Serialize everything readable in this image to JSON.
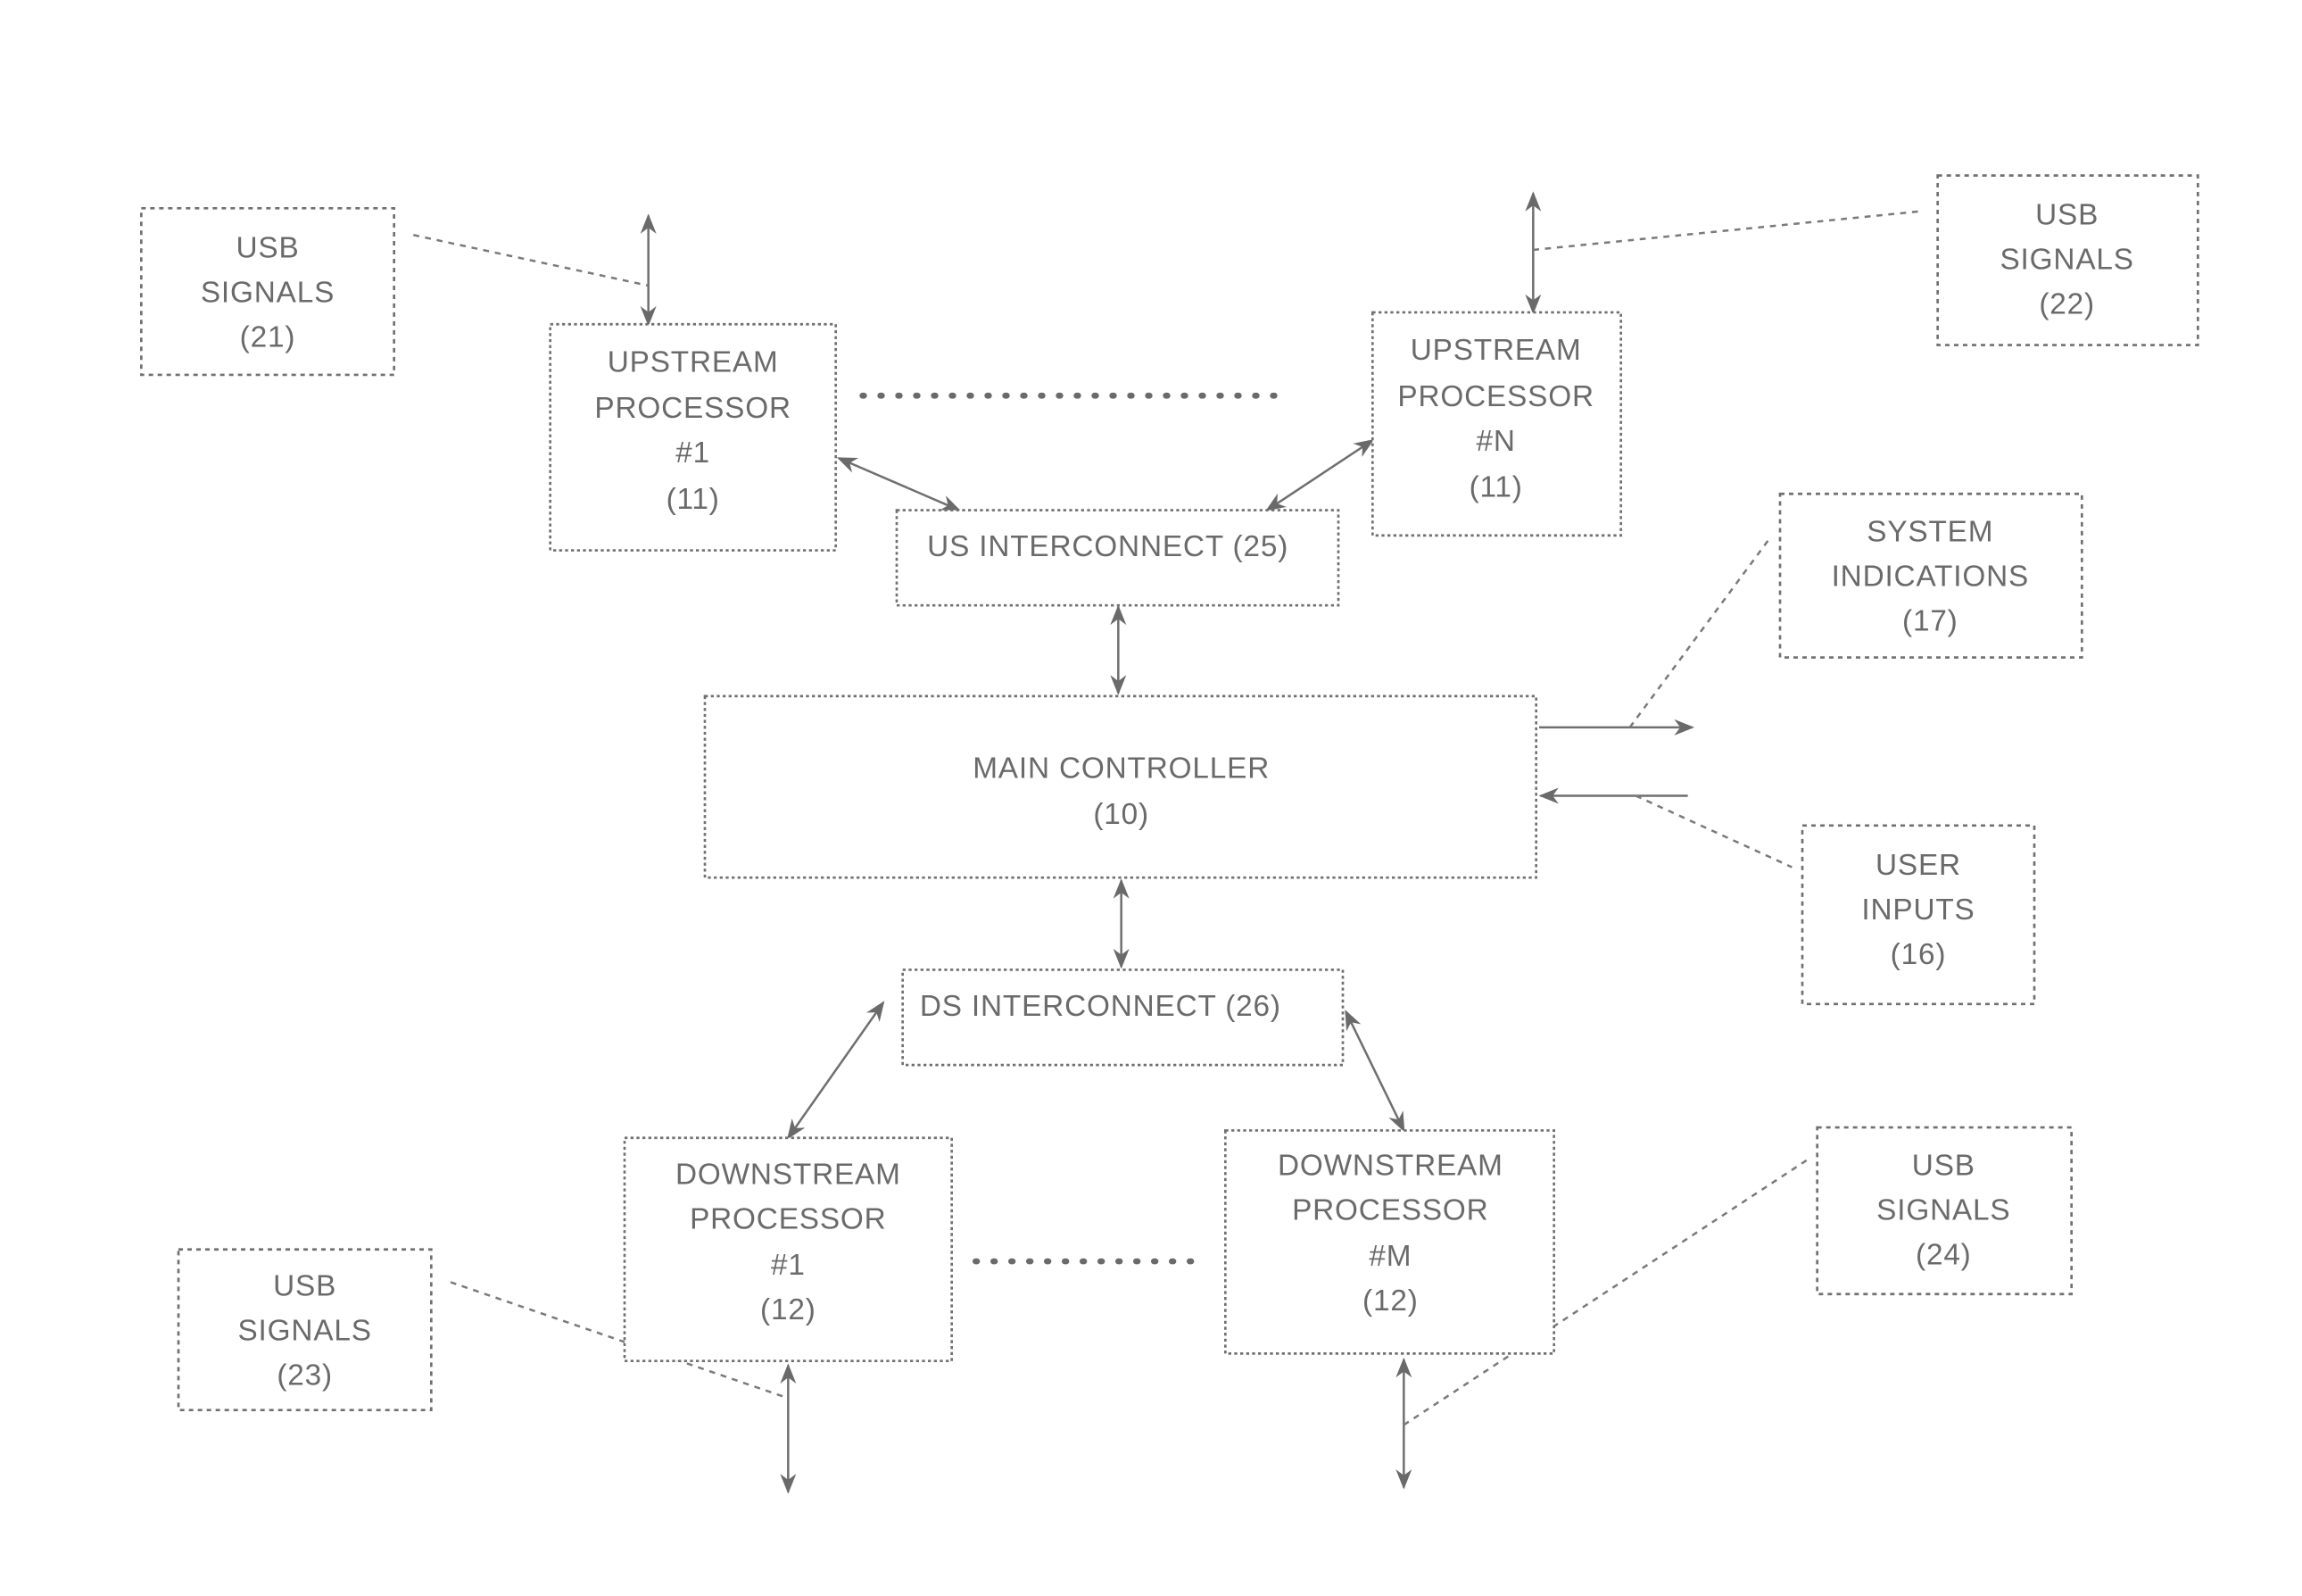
{
  "diagram": {
    "nodes": {
      "usb21": {
        "lines": [
          "USB",
          "SIGNALS",
          "(21)"
        ],
        "style": "dashed"
      },
      "usb22": {
        "lines": [
          "USB",
          "SIGNALS",
          "(22)"
        ],
        "style": "dashed"
      },
      "usb23": {
        "lines": [
          "USB",
          "SIGNALS",
          "(23)"
        ],
        "style": "dashed"
      },
      "usb24": {
        "lines": [
          "USB",
          "SIGNALS",
          "(24)"
        ],
        "style": "dashed"
      },
      "up1": {
        "lines": [
          "UPSTREAM",
          "PROCESSOR",
          "#1",
          "(11)"
        ],
        "style": "solid"
      },
      "upn": {
        "lines": [
          "UPSTREAM",
          "PROCESSOR",
          "#N",
          "(11)"
        ],
        "style": "solid"
      },
      "us_interconnect": {
        "lines": [
          "US INTERCONNECT (25)"
        ],
        "style": "solid"
      },
      "main_controller": {
        "lines": [
          "MAIN CONTROLLER",
          "(10)"
        ],
        "style": "solid"
      },
      "ds_interconnect": {
        "lines": [
          "DS INTERCONNECT (26)"
        ],
        "style": "solid"
      },
      "dp1": {
        "lines": [
          "DOWNSTREAM",
          "PROCESSOR",
          "#1",
          "(12)"
        ],
        "style": "solid"
      },
      "dpm": {
        "lines": [
          "DOWNSTREAM",
          "PROCESSOR",
          "#M",
          "(12)"
        ],
        "style": "solid"
      },
      "system_indications": {
        "lines": [
          "SYSTEM",
          "INDICATIONS",
          "(17)"
        ],
        "style": "dashed"
      },
      "user_inputs": {
        "lines": [
          "USER",
          "INPUTS",
          "(16)"
        ],
        "style": "dashed"
      }
    },
    "edges": [
      {
        "from": "up1",
        "to": "us_interconnect",
        "type": "bidirectional"
      },
      {
        "from": "upn",
        "to": "us_interconnect",
        "type": "bidirectional"
      },
      {
        "from": "us_interconnect",
        "to": "main_controller",
        "type": "bidirectional"
      },
      {
        "from": "main_controller",
        "to": "ds_interconnect",
        "type": "bidirectional"
      },
      {
        "from": "ds_interconnect",
        "to": "dp1",
        "type": "bidirectional"
      },
      {
        "from": "ds_interconnect",
        "to": "dpm",
        "type": "bidirectional"
      },
      {
        "from": "main_controller",
        "to": "system_indications",
        "type": "output"
      },
      {
        "from": "user_inputs",
        "to": "main_controller",
        "type": "input"
      },
      {
        "from": "up1",
        "to": "external",
        "type": "bidirectional",
        "label_ref": "usb21"
      },
      {
        "from": "upn",
        "to": "external",
        "type": "bidirectional",
        "label_ref": "usb22"
      },
      {
        "from": "dp1",
        "to": "external",
        "type": "bidirectional",
        "label_ref": "usb23"
      },
      {
        "from": "dpm",
        "to": "external",
        "type": "bidirectional",
        "label_ref": "usb24"
      }
    ],
    "ellipses": [
      "upstream processors 1..N",
      "downstream processors 1..M"
    ]
  }
}
